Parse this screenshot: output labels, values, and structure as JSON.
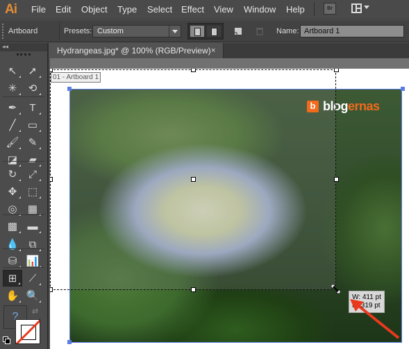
{
  "app": {
    "logo": "Ai",
    "menu": [
      "File",
      "Edit",
      "Object",
      "Type",
      "Select",
      "Effect",
      "View",
      "Window",
      "Help"
    ],
    "bridge_button": "Br",
    "workspace_icon": "workspace-layout-icon"
  },
  "control_bar": {
    "tool_label": "Artboard",
    "presets_label": "Presets:",
    "preset_value": "Custom",
    "orientation": [
      "portrait",
      "landscape"
    ],
    "name_label": "Name:",
    "name_value": "Artboard 1"
  },
  "tool_panel": {
    "collapse_glyph": "◂◂",
    "tools": [
      {
        "name": "selection-tool",
        "glyph": "↖"
      },
      {
        "name": "direct-selection-tool",
        "glyph": "➚"
      },
      {
        "name": "magic-wand-tool",
        "glyph": "✳"
      },
      {
        "name": "lasso-tool",
        "glyph": "⟲"
      },
      {
        "name": "pen-tool",
        "glyph": "✒"
      },
      {
        "name": "type-tool",
        "glyph": "T"
      },
      {
        "name": "line-segment-tool",
        "glyph": "╱"
      },
      {
        "name": "rectangle-tool",
        "glyph": "▭"
      },
      {
        "name": "paintbrush-tool",
        "glyph": "🖌"
      },
      {
        "name": "pencil-tool",
        "glyph": "✎"
      },
      {
        "name": "blob-brush-tool",
        "glyph": "◪"
      },
      {
        "name": "eraser-tool",
        "glyph": "▰"
      },
      {
        "name": "rotate-tool",
        "glyph": "↻"
      },
      {
        "name": "scale-tool",
        "glyph": "⤢"
      },
      {
        "name": "puppet-warp-tool",
        "glyph": "✥"
      },
      {
        "name": "free-transform-tool",
        "glyph": "⬚"
      },
      {
        "name": "shape-builder-tool",
        "glyph": "◎"
      },
      {
        "name": "perspective-grid-tool",
        "glyph": "▦"
      },
      {
        "name": "mesh-tool",
        "glyph": "▩"
      },
      {
        "name": "gradient-tool",
        "glyph": "▬"
      },
      {
        "name": "eyedropper-tool",
        "glyph": "💧"
      },
      {
        "name": "blend-tool",
        "glyph": "⧉"
      },
      {
        "name": "symbol-sprayer-tool",
        "glyph": "⛁"
      },
      {
        "name": "column-graph-tool",
        "glyph": "📊"
      },
      {
        "name": "artboard-tool",
        "glyph": "⊞"
      },
      {
        "name": "slice-tool",
        "glyph": "⟋"
      },
      {
        "name": "hand-tool",
        "glyph": "✋"
      },
      {
        "name": "zoom-tool",
        "glyph": "🔍"
      }
    ],
    "fill_glyph": "?",
    "swap_glyph": "⇄"
  },
  "document": {
    "tab_title": "Hydrangeas.jpg* @ 100% (RGB/Preview)",
    "tab_close": "×",
    "artboard_label": "01 - Artboard 1"
  },
  "image_overlay": {
    "logo_letter": "b",
    "logo_text_white": "blog",
    "logo_text_orange": "ernas",
    "brand_color": "#f26a1b"
  },
  "tooltip": {
    "width": "W: 411 pt",
    "height": "H: 319 pt"
  },
  "colors": {
    "accent_selection": "#5a7ee6",
    "annotation_arrow": "#e8391e",
    "ai_logo": "#e38d36"
  }
}
